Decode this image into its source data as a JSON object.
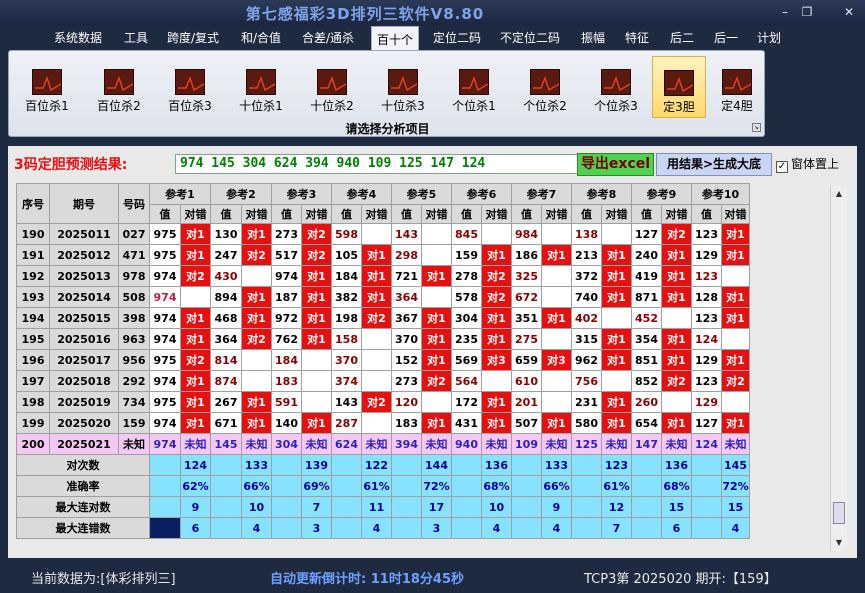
{
  "app": {
    "title": "第七感福彩3D排列三软件V8.80"
  },
  "window_controls": {
    "minimize": "–",
    "maximize": "❐",
    "close": "✕"
  },
  "menu": [
    "系统数据",
    "工具",
    "跨度/复式",
    "和/合值",
    "合差/通杀",
    "百十个",
    "定位二码",
    "不定位二码",
    "振幅",
    "特征",
    "后二",
    "后一",
    "计划"
  ],
  "ribbon": {
    "buttons": [
      "百位杀1",
      "百位杀2",
      "百位杀3",
      "十位杀1",
      "十位杀2",
      "十位杀3",
      "个位杀1",
      "个位杀2",
      "个位杀3",
      "定3胆",
      "定4胆"
    ],
    "caption": "请选择分析项目"
  },
  "prediction": {
    "label": "3码定胆预测结果:",
    "value": "974 145 304 624 394 940 109 125 147 124",
    "export_label": "导出excel",
    "generate_label": "用结果>生成大底",
    "topmost_label": "窗体置上",
    "topmost_checked": "✓"
  },
  "table": {
    "headers": {
      "seq": "序号",
      "period": "期号",
      "number": "号码",
      "val": "值",
      "check": "对错"
    },
    "refs": [
      "参考1",
      "参考2",
      "参考3",
      "参考4",
      "参考5",
      "参考6",
      "参考7",
      "参考8",
      "参考9",
      "参考10"
    ],
    "rows": [
      {
        "seq": "190",
        "period": "2025011",
        "num": "027",
        "cells": [
          [
            "975",
            ""
          ],
          [
            "对1",
            "r"
          ],
          [
            "130",
            ""
          ],
          [
            "对1",
            "r"
          ],
          [
            "273",
            ""
          ],
          [
            "对2",
            "r"
          ],
          [
            "598",
            "d"
          ],
          [
            "",
            ""
          ],
          [
            "143",
            "d"
          ],
          [
            "",
            ""
          ],
          [
            "845",
            "d"
          ],
          [
            "",
            ""
          ],
          [
            "984",
            "d"
          ],
          [
            "",
            ""
          ],
          [
            "138",
            "d"
          ],
          [
            "",
            ""
          ],
          [
            "127",
            ""
          ],
          [
            "对2",
            "r"
          ],
          [
            "123",
            ""
          ],
          [
            "对1",
            "r"
          ]
        ]
      },
      {
        "seq": "191",
        "period": "2025012",
        "num": "471",
        "cells": [
          [
            "975",
            ""
          ],
          [
            "对1",
            "r"
          ],
          [
            "247",
            ""
          ],
          [
            "对2",
            "r"
          ],
          [
            "517",
            ""
          ],
          [
            "对2",
            "r"
          ],
          [
            "105",
            ""
          ],
          [
            "对1",
            "r"
          ],
          [
            "298",
            "d"
          ],
          [
            "",
            ""
          ],
          [
            "159",
            ""
          ],
          [
            "对1",
            "r"
          ],
          [
            "186",
            ""
          ],
          [
            "对1",
            "r"
          ],
          [
            "213",
            ""
          ],
          [
            "对1",
            "r"
          ],
          [
            "240",
            ""
          ],
          [
            "对1",
            "r"
          ],
          [
            "129",
            ""
          ],
          [
            "对1",
            "r"
          ]
        ]
      },
      {
        "seq": "192",
        "period": "2025013",
        "num": "978",
        "cells": [
          [
            "974",
            ""
          ],
          [
            "对2",
            "r"
          ],
          [
            "430",
            "d"
          ],
          [
            "",
            ""
          ],
          [
            "974",
            ""
          ],
          [
            "对1",
            "r"
          ],
          [
            "184",
            ""
          ],
          [
            "对1",
            "r"
          ],
          [
            "721",
            ""
          ],
          [
            "对1",
            "r"
          ],
          [
            "278",
            ""
          ],
          [
            "对2",
            "r"
          ],
          [
            "325",
            "d"
          ],
          [
            "",
            ""
          ],
          [
            "372",
            ""
          ],
          [
            "对1",
            "r"
          ],
          [
            "419",
            ""
          ],
          [
            "对1",
            "r"
          ],
          [
            "123",
            "d"
          ],
          [
            "",
            ""
          ]
        ]
      },
      {
        "seq": "193",
        "period": "2025014",
        "num": "508",
        "cells": [
          [
            "974",
            "p"
          ],
          [
            "",
            ""
          ],
          [
            "894",
            ""
          ],
          [
            "对1",
            "r"
          ],
          [
            "187",
            ""
          ],
          [
            "对1",
            "r"
          ],
          [
            "382",
            ""
          ],
          [
            "对1",
            "r"
          ],
          [
            "364",
            "d"
          ],
          [
            "",
            ""
          ],
          [
            "578",
            ""
          ],
          [
            "对2",
            "r"
          ],
          [
            "672",
            "d"
          ],
          [
            "",
            ""
          ],
          [
            "740",
            ""
          ],
          [
            "对1",
            "r"
          ],
          [
            "871",
            ""
          ],
          [
            "对1",
            "r"
          ],
          [
            "128",
            ""
          ],
          [
            "对1",
            "r"
          ]
        ]
      },
      {
        "seq": "194",
        "period": "2025015",
        "num": "398",
        "cells": [
          [
            "974",
            ""
          ],
          [
            "对1",
            "r"
          ],
          [
            "468",
            ""
          ],
          [
            "对1",
            "r"
          ],
          [
            "972",
            ""
          ],
          [
            "对1",
            "r"
          ],
          [
            "198",
            ""
          ],
          [
            "对2",
            "r"
          ],
          [
            "367",
            ""
          ],
          [
            "对1",
            "r"
          ],
          [
            "304",
            ""
          ],
          [
            "对1",
            "r"
          ],
          [
            "351",
            ""
          ],
          [
            "对1",
            "r"
          ],
          [
            "402",
            "d"
          ],
          [
            "",
            ""
          ],
          [
            "452",
            "d"
          ],
          [
            "",
            ""
          ],
          [
            "123",
            ""
          ],
          [
            "对1",
            "r"
          ]
        ]
      },
      {
        "seq": "195",
        "period": "2025016",
        "num": "963",
        "cells": [
          [
            "974",
            ""
          ],
          [
            "对1",
            "r"
          ],
          [
            "364",
            ""
          ],
          [
            "对2",
            "r"
          ],
          [
            "762",
            ""
          ],
          [
            "对1",
            "r"
          ],
          [
            "158",
            "d"
          ],
          [
            "",
            ""
          ],
          [
            "370",
            ""
          ],
          [
            "对1",
            "r"
          ],
          [
            "235",
            ""
          ],
          [
            "对1",
            "r"
          ],
          [
            "275",
            "d"
          ],
          [
            "",
            ""
          ],
          [
            "315",
            ""
          ],
          [
            "对1",
            "r"
          ],
          [
            "354",
            ""
          ],
          [
            "对1",
            "r"
          ],
          [
            "124",
            "d"
          ],
          [
            "",
            ""
          ]
        ]
      },
      {
        "seq": "196",
        "period": "2025017",
        "num": "956",
        "cells": [
          [
            "975",
            ""
          ],
          [
            "对2",
            "r"
          ],
          [
            "814",
            "d"
          ],
          [
            "",
            ""
          ],
          [
            "184",
            "d"
          ],
          [
            "",
            ""
          ],
          [
            "370",
            "d"
          ],
          [
            "",
            ""
          ],
          [
            "152",
            ""
          ],
          [
            "对1",
            "r"
          ],
          [
            "569",
            ""
          ],
          [
            "对3",
            "r"
          ],
          [
            "659",
            ""
          ],
          [
            "对3",
            "r"
          ],
          [
            "962",
            ""
          ],
          [
            "对1",
            "r"
          ],
          [
            "851",
            ""
          ],
          [
            "对1",
            "r"
          ],
          [
            "129",
            ""
          ],
          [
            "对1",
            "r"
          ]
        ]
      },
      {
        "seq": "197",
        "period": "2025018",
        "num": "292",
        "cells": [
          [
            "974",
            ""
          ],
          [
            "对1",
            "r"
          ],
          [
            "874",
            "d"
          ],
          [
            "",
            ""
          ],
          [
            "183",
            "d"
          ],
          [
            "",
            ""
          ],
          [
            "374",
            "d"
          ],
          [
            "",
            ""
          ],
          [
            "273",
            ""
          ],
          [
            "对2",
            "r"
          ],
          [
            "564",
            "d"
          ],
          [
            "",
            ""
          ],
          [
            "610",
            "d"
          ],
          [
            "",
            ""
          ],
          [
            "756",
            "d"
          ],
          [
            "",
            ""
          ],
          [
            "852",
            ""
          ],
          [
            "对2",
            "r"
          ],
          [
            "123",
            ""
          ],
          [
            "对2",
            "r"
          ]
        ]
      },
      {
        "seq": "198",
        "period": "2025019",
        "num": "734",
        "cells": [
          [
            "975",
            ""
          ],
          [
            "对1",
            "r"
          ],
          [
            "267",
            ""
          ],
          [
            "对1",
            "r"
          ],
          [
            "591",
            "d"
          ],
          [
            "",
            ""
          ],
          [
            "143",
            ""
          ],
          [
            "对2",
            "r"
          ],
          [
            "120",
            "d"
          ],
          [
            "",
            ""
          ],
          [
            "172",
            ""
          ],
          [
            "对1",
            "r"
          ],
          [
            "201",
            "d"
          ],
          [
            "",
            ""
          ],
          [
            "231",
            ""
          ],
          [
            "对1",
            "r"
          ],
          [
            "260",
            "d"
          ],
          [
            "",
            ""
          ],
          [
            "129",
            "d"
          ],
          [
            "",
            ""
          ]
        ]
      },
      {
        "seq": "199",
        "period": "2025020",
        "num": "159",
        "cells": [
          [
            "974",
            ""
          ],
          [
            "对1",
            "r"
          ],
          [
            "671",
            ""
          ],
          [
            "对1",
            "r"
          ],
          [
            "140",
            ""
          ],
          [
            "对1",
            "r"
          ],
          [
            "287",
            "d"
          ],
          [
            "",
            ""
          ],
          [
            "183",
            ""
          ],
          [
            "对1",
            "r"
          ],
          [
            "431",
            ""
          ],
          [
            "对1",
            "r"
          ],
          [
            "507",
            ""
          ],
          [
            "对1",
            "r"
          ],
          [
            "580",
            ""
          ],
          [
            "对1",
            "r"
          ],
          [
            "654",
            ""
          ],
          [
            "对1",
            "r"
          ],
          [
            "127",
            ""
          ],
          [
            "对1",
            "r"
          ]
        ]
      }
    ],
    "predict_row": {
      "seq": "200",
      "period": "2025021",
      "num": "未知",
      "values": [
        "974",
        "145",
        "304",
        "624",
        "394",
        "940",
        "109",
        "125",
        "147",
        "124"
      ],
      "unknown": "未知"
    },
    "stats": [
      {
        "label": "对次数",
        "values": [
          "124",
          "133",
          "139",
          "122",
          "144",
          "136",
          "133",
          "123",
          "136",
          "145"
        ]
      },
      {
        "label": "准确率",
        "values": [
          "62%",
          "66%",
          "69%",
          "61%",
          "72%",
          "68%",
          "66%",
          "61%",
          "68%",
          "72%"
        ]
      },
      {
        "label": "最大连对数",
        "values": [
          "9",
          "10",
          "7",
          "11",
          "17",
          "10",
          "9",
          "12",
          "15",
          "15"
        ]
      },
      {
        "label": "最大连错数",
        "values": [
          "6",
          "4",
          "3",
          "4",
          "3",
          "4",
          "4",
          "7",
          "6",
          "4"
        ]
      }
    ]
  },
  "status": {
    "data_label": "当前数据为:[体彩排列三]",
    "countdown": "自动更新倒计时: 11时18分45秒",
    "draw_info": "TCP3第 2025020 期开:【159】"
  },
  "colors": {
    "hit": "#e51010",
    "miss_text": "#8a0000",
    "stat_bg": "#86e2ff",
    "predict_bg": "#f3c9f3"
  }
}
